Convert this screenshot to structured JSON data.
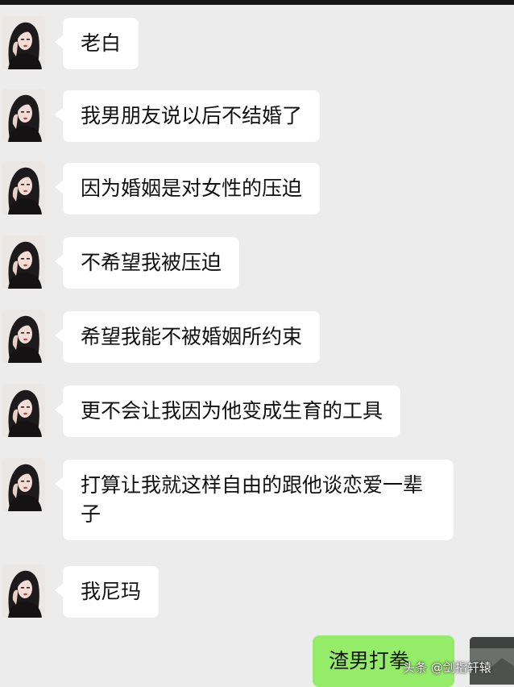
{
  "theme": {
    "background": "#ececec",
    "received_bubble": "#ffffff",
    "sent_bubble": "#95ec69",
    "text": "#111111"
  },
  "messages": [
    {
      "sender": "contact",
      "text": "老白"
    },
    {
      "sender": "contact",
      "text": "我男朋友说以后不结婚了"
    },
    {
      "sender": "contact",
      "text": "因为婚姻是对女性的压迫"
    },
    {
      "sender": "contact",
      "text": "不希望我被压迫"
    },
    {
      "sender": "contact",
      "text": "希望我能不被婚姻所约束"
    },
    {
      "sender": "contact",
      "text": "更不会让我因为他变成生育的工具"
    },
    {
      "sender": "contact",
      "text": "打算让我就这样自由的跟他谈恋爱一辈子"
    },
    {
      "sender": "contact",
      "text": "我尼玛"
    },
    {
      "sender": "self",
      "text": "渣男打拳"
    }
  ],
  "watermark": "头条 @剑指轩辕"
}
